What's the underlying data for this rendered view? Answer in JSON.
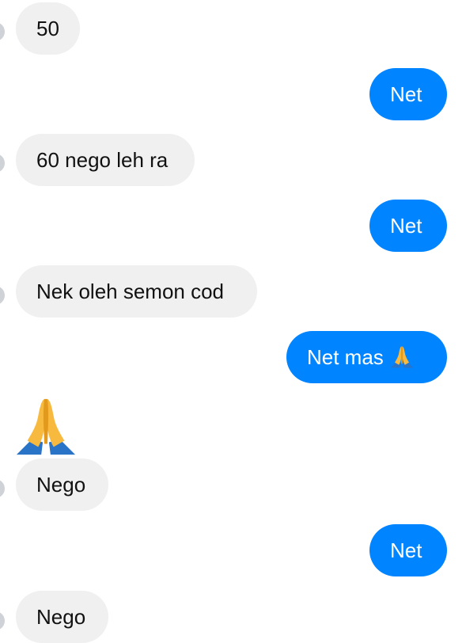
{
  "conversation": {
    "messages": [
      {
        "side": "incoming",
        "text": "50"
      },
      {
        "side": "outgoing",
        "text": "Net"
      },
      {
        "side": "incoming",
        "text": "60 nego leh ra"
      },
      {
        "side": "outgoing",
        "text": "Net"
      },
      {
        "side": "incoming",
        "text": "Nek oleh semon cod"
      },
      {
        "side": "outgoing",
        "text": "Net mas",
        "emoji": "folded-hands"
      },
      {
        "side": "incoming",
        "emoji_only": "folded-hands"
      },
      {
        "side": "incoming",
        "text": "Nego"
      },
      {
        "side": "outgoing",
        "text": "Net"
      },
      {
        "side": "incoming",
        "text": "Nego"
      }
    ]
  },
  "colors": {
    "outgoing_bubble": "#0084ff",
    "incoming_bubble": "#f0f0f0"
  }
}
